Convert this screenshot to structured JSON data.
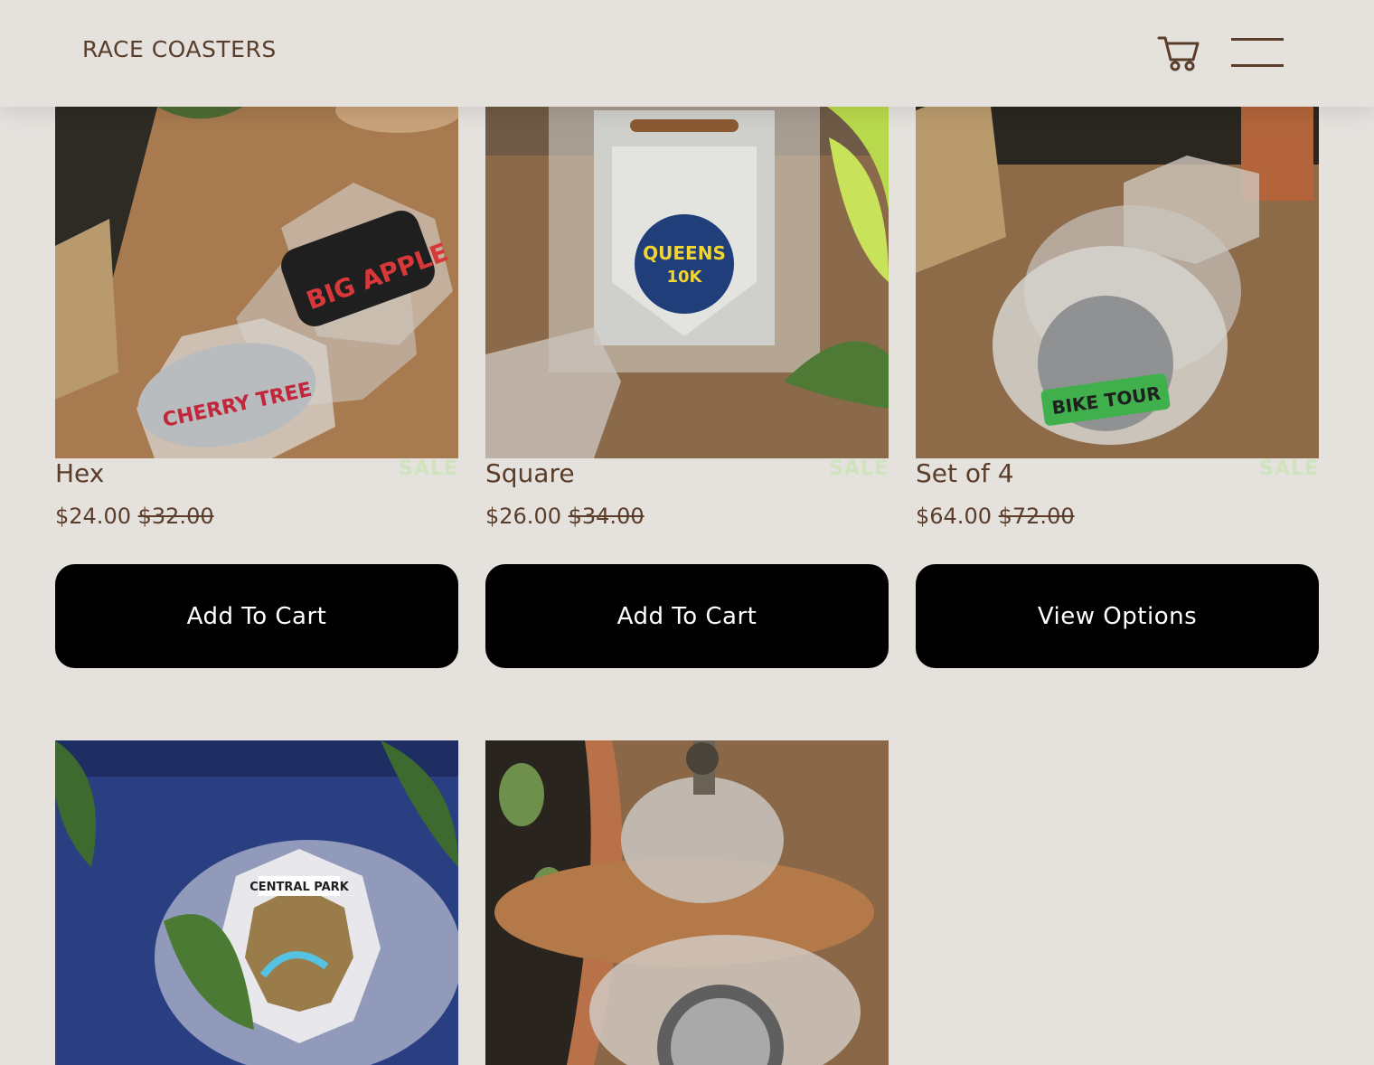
{
  "header": {
    "brand": "RACE COASTERS",
    "cart_icon": "shopping-cart-icon",
    "menu_icon": "hamburger-menu-icon"
  },
  "colors": {
    "background": "#e5e2de",
    "text": "#5a3e2b",
    "sale": "#cfe3bf",
    "button": "#000000",
    "button_text": "#ffffff"
  },
  "products": [
    {
      "title": "Hex",
      "sale_label": "SALE",
      "price": "$24.00",
      "original_price": "$32.00",
      "button": "Add To Cart"
    },
    {
      "title": "Square",
      "sale_label": "SALE",
      "price": "$26.00",
      "original_price": "$34.00",
      "button": "Add To Cart"
    },
    {
      "title": "Set of 4",
      "sale_label": "SALE",
      "price": "$64.00",
      "original_price": "$72.00",
      "button": "View Options"
    },
    {},
    {}
  ]
}
